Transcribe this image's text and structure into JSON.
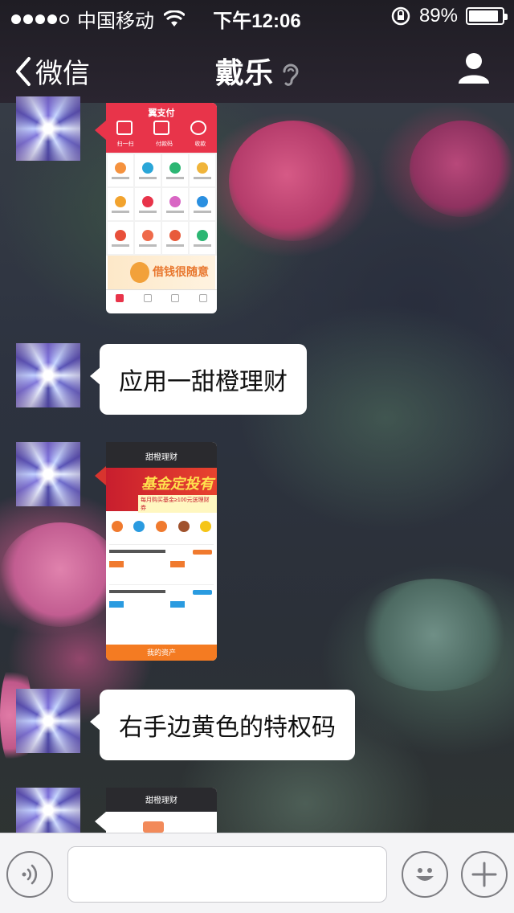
{
  "status_bar": {
    "carrier": "中国移动",
    "time": "下午12:06",
    "battery": "89%",
    "battery_level": 0.89
  },
  "nav": {
    "back_label": "微信",
    "title": "戴乐"
  },
  "messages": [
    {
      "type": "image",
      "content": "yizhifu-app-screenshot"
    },
    {
      "type": "text",
      "text": "应用一甜橙理财"
    },
    {
      "type": "image",
      "content": "tiancheng-licai-screenshot"
    },
    {
      "type": "text",
      "text": "右手边黄色的特权码"
    },
    {
      "type": "image",
      "content": "tiancheng-licai-screenshot-partial"
    }
  ],
  "shot1": {
    "header": "翼支付",
    "tabs": [
      "扫一扫",
      "付款码",
      "收款"
    ],
    "banner": "借钱很随意"
  },
  "shot2": {
    "title": "甜橙理财",
    "banner_title": "基金定投有礼",
    "banner_sub": "每月购买基金≥100元送理财券",
    "footer": "我的资产"
  },
  "shot3": {
    "title": "甜橙理财"
  },
  "input": {
    "placeholder": ""
  },
  "colors": {
    "nav_bg": "#231f29",
    "bubble_bg": "#ffffff",
    "input_bar_bg": "#f4f4f6"
  }
}
